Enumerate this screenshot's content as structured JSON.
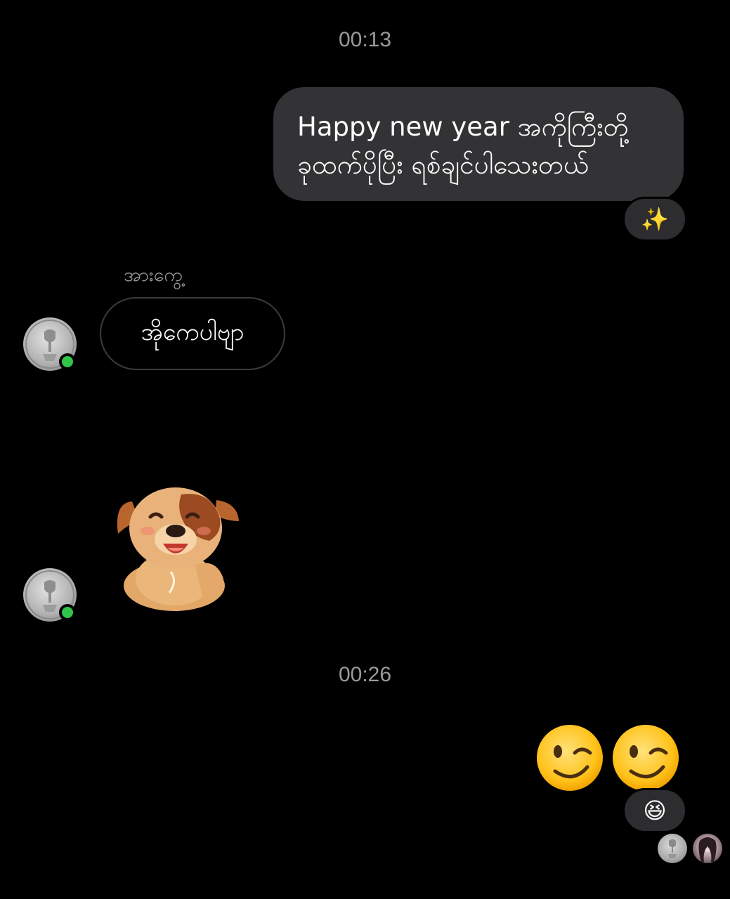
{
  "timestamps": [
    "00:13",
    "00:26"
  ],
  "outgoing_message": {
    "line1": "Happy new year အကိုကြီးတို့",
    "line2": "ခုထက်ပိုပြီး ရစ်ချင်ပါသေးတယ်",
    "reaction": "✨"
  },
  "incoming": {
    "sender_name": "အားကွေ့",
    "message": "အိုကေပါဗျာ",
    "sticker": "smiling-dog-sticker"
  },
  "outgoing_emojis": {
    "icons": [
      "winking-face-icon",
      "winking-face-icon"
    ],
    "reaction": "😆"
  },
  "colors": {
    "background": "#000000",
    "outgoing_bubble": "#333335",
    "incoming_border": "#3c3c3e",
    "online": "#31c54a",
    "timestamp": "#9a9a9a"
  }
}
